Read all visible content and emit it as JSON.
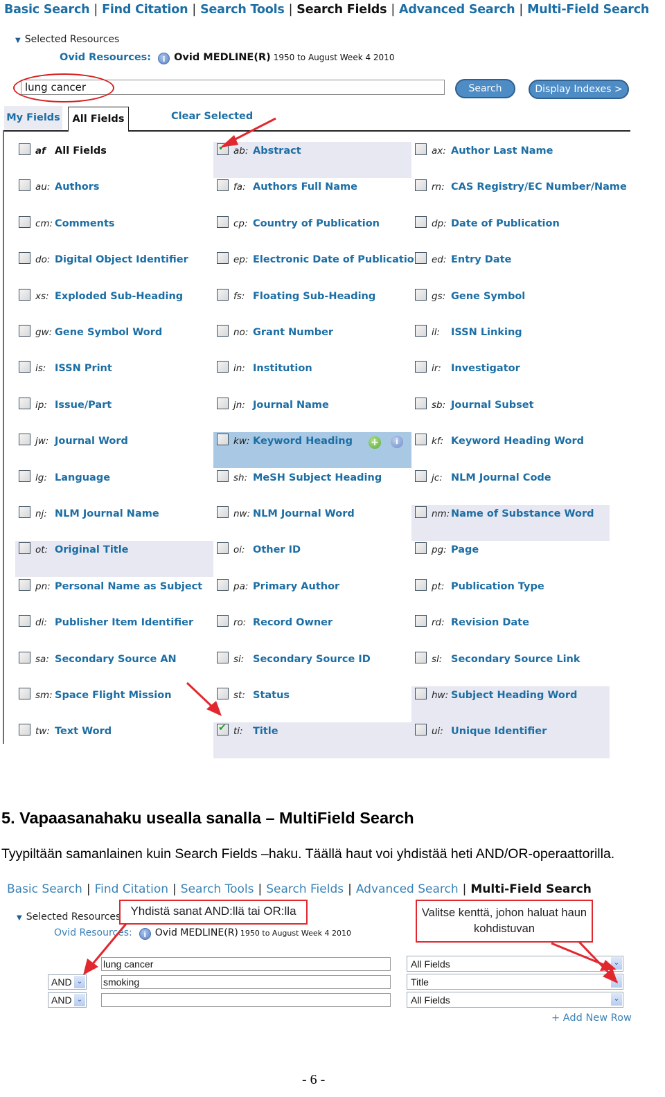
{
  "screenshot1": {
    "nav": {
      "items": [
        {
          "label": "Basic Search",
          "active": false
        },
        {
          "label": "Find Citation",
          "active": false
        },
        {
          "label": "Search Tools",
          "active": false
        },
        {
          "label": "Search Fields",
          "active": true
        },
        {
          "label": "Advanced Search",
          "active": false
        },
        {
          "label": "Multi-Field Search",
          "active": false
        }
      ],
      "separator": "|"
    },
    "selected_resources": {
      "label": "Selected Resources",
      "toggle_icon": "▼",
      "ovid_label": "Ovid Resources:",
      "info_icon": "i",
      "database": "Ovid MEDLINE(R)",
      "dates": "1950 to August Week 4 2010"
    },
    "search": {
      "value": "lung cancer",
      "search_button": "Search",
      "display_indexes_button": "Display Indexes >"
    },
    "tabs": {
      "my_fields": "My Fields",
      "all_fields": "All Fields",
      "clear_selected": "Clear Selected"
    },
    "fields": [
      {
        "code": "af",
        "name": "All Fields",
        "checked": false
      },
      {
        "code": "ab:",
        "name": "Abstract",
        "checked": true
      },
      {
        "code": "ax:",
        "name": "Author Last Name",
        "checked": false
      },
      {
        "code": "au:",
        "name": "Authors",
        "checked": false
      },
      {
        "code": "fa:",
        "name": "Authors Full Name",
        "checked": false
      },
      {
        "code": "rn:",
        "name": "CAS Registry/EC Number/Name",
        "checked": false
      },
      {
        "code": "cm:",
        "name": "Comments",
        "checked": false
      },
      {
        "code": "cp:",
        "name": "Country of Publication",
        "checked": false
      },
      {
        "code": "dp:",
        "name": "Date of Publication",
        "checked": false
      },
      {
        "code": "do:",
        "name": "Digital Object Identifier",
        "checked": false
      },
      {
        "code": "ep:",
        "name": "Electronic Date of Publication",
        "checked": false
      },
      {
        "code": "ed:",
        "name": "Entry Date",
        "checked": false
      },
      {
        "code": "xs:",
        "name": "Exploded Sub-Heading",
        "checked": false
      },
      {
        "code": "fs:",
        "name": "Floating Sub-Heading",
        "checked": false
      },
      {
        "code": "gs:",
        "name": "Gene Symbol",
        "checked": false
      },
      {
        "code": "gw:",
        "name": "Gene Symbol Word",
        "checked": false
      },
      {
        "code": "no:",
        "name": "Grant Number",
        "checked": false
      },
      {
        "code": "il:",
        "name": "ISSN Linking",
        "checked": false
      },
      {
        "code": "is:",
        "name": "ISSN Print",
        "checked": false
      },
      {
        "code": "in:",
        "name": "Institution",
        "checked": false
      },
      {
        "code": "ir:",
        "name": "Investigator",
        "checked": false
      },
      {
        "code": "ip:",
        "name": "Issue/Part",
        "checked": false
      },
      {
        "code": "jn:",
        "name": "Journal Name",
        "checked": false
      },
      {
        "code": "sb:",
        "name": "Journal Subset",
        "checked": false
      },
      {
        "code": "jw:",
        "name": "Journal Word",
        "checked": false
      },
      {
        "code": "kw:",
        "name": "Keyword Heading",
        "checked": false
      },
      {
        "code": "kf:",
        "name": "Keyword Heading Word",
        "checked": false
      },
      {
        "code": "lg:",
        "name": "Language",
        "checked": false
      },
      {
        "code": "sh:",
        "name": "MeSH Subject Heading",
        "checked": false
      },
      {
        "code": "jc:",
        "name": "NLM Journal Code",
        "checked": false
      },
      {
        "code": "nj:",
        "name": "NLM Journal Name",
        "checked": false
      },
      {
        "code": "nw:",
        "name": "NLM Journal Word",
        "checked": false
      },
      {
        "code": "nm:",
        "name": "Name of Substance Word",
        "checked": false
      },
      {
        "code": "ot:",
        "name": "Original Title",
        "checked": false
      },
      {
        "code": "oi:",
        "name": "Other ID",
        "checked": false
      },
      {
        "code": "pg:",
        "name": "Page",
        "checked": false
      },
      {
        "code": "pn:",
        "name": "Personal Name as Subject",
        "checked": false
      },
      {
        "code": "pa:",
        "name": "Primary Author",
        "checked": false
      },
      {
        "code": "pt:",
        "name": "Publication Type",
        "checked": false
      },
      {
        "code": "di:",
        "name": "Publisher Item Identifier",
        "checked": false
      },
      {
        "code": "ro:",
        "name": "Record Owner",
        "checked": false
      },
      {
        "code": "rd:",
        "name": "Revision Date",
        "checked": false
      },
      {
        "code": "sa:",
        "name": "Secondary Source AN",
        "checked": false
      },
      {
        "code": "si:",
        "name": "Secondary Source ID",
        "checked": false
      },
      {
        "code": "sl:",
        "name": "Secondary Source Link",
        "checked": false
      },
      {
        "code": "sm:",
        "name": "Space Flight Mission",
        "checked": false
      },
      {
        "code": "st:",
        "name": "Status",
        "checked": false
      },
      {
        "code": "hw:",
        "name": "Subject Heading Word",
        "checked": false
      },
      {
        "code": "tw:",
        "name": "Text Word",
        "checked": false
      },
      {
        "code": "ti:",
        "name": "Title",
        "checked": true
      },
      {
        "code": "ui:",
        "name": "Unique Identifier",
        "checked": false
      }
    ],
    "hover_row_icons": {
      "add": "+",
      "info": "i"
    }
  },
  "document": {
    "heading": "5.  Vapaasanahaku usealla sanalla – MultiField Search",
    "paragraph": "Tyypiltään samanlainen kuin Search Fields –haku. Täällä haut voi yhdistää heti AND/OR-operaattorilla.",
    "page_number": "- 6 -"
  },
  "screenshot2": {
    "nav": {
      "items": [
        {
          "label": "Basic Search",
          "active": false
        },
        {
          "label": "Find Citation",
          "active": false
        },
        {
          "label": "Search Tools",
          "active": false
        },
        {
          "label": "Search Fields",
          "active": false
        },
        {
          "label": "Advanced Search",
          "active": false
        },
        {
          "label": "Multi-Field Search",
          "active": true
        }
      ],
      "separator": "|"
    },
    "selected_resources": {
      "label": "Selected Resources",
      "toggle_icon": "▼",
      "ovid_label": "Ovid Resources:",
      "info_icon": "i",
      "database": "Ovid MEDLINE(R)",
      "dates": "1950 to August Week 4 2010"
    },
    "callouts": {
      "operators": "Yhdistä sanat AND:llä tai OR:lla",
      "fields": "Valitse kenttä, johon haluat haun kohdistuvan"
    },
    "rows": [
      {
        "operator": null,
        "term": "lung cancer",
        "field": "All Fields"
      },
      {
        "operator": "AND",
        "term": "smoking",
        "field": "Title"
      },
      {
        "operator": "AND",
        "term": "",
        "field": "All Fields"
      }
    ],
    "dropdown_icon": "⌄",
    "add_new_row": "+ Add New Row"
  },
  "colors": {
    "link_blue": "#1c6ea4",
    "annotation_red": "#e0282e",
    "row_highlight": "#e8e8f2",
    "hover_highlight": "#a9c8e4",
    "check_green": "#22a234"
  }
}
